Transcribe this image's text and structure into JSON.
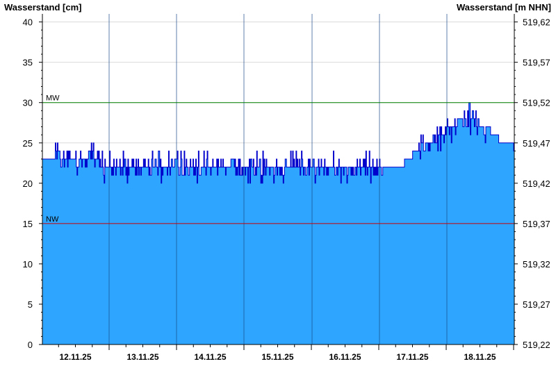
{
  "chart_data": {
    "type": "area",
    "left_axis_title": "Wasserstand [cm]",
    "right_axis_title": "Wasserstand [m NHN]",
    "ylim": [
      0,
      41
    ],
    "y_ticks": [
      0,
      5,
      10,
      15,
      20,
      25,
      30,
      35,
      40
    ],
    "y_tick_labels": [
      "0",
      "5",
      "10",
      "15",
      "20",
      "25",
      "30",
      "35",
      "40"
    ],
    "right_tick_labels": [
      "519,22",
      "519,27",
      "519,32",
      "519,37",
      "519,42",
      "519,47",
      "519,52",
      "519,57",
      "519,62"
    ],
    "x_range": [
      "2025-11-11T18:00",
      "2025-11-18T24:00"
    ],
    "day_boundaries": [
      "12.11.25 24:00",
      "13.11.25 24:00",
      "14.11.25 24:00",
      "15.11.25 24:00",
      "16.11.25 24:00",
      "17.11.25 24:00"
    ],
    "date_labels": [
      "12.11.25",
      "13.11.25",
      "14.11.25",
      "15.11.25",
      "16.11.25",
      "17.11.25",
      "18.11.25"
    ],
    "reference_lines": [
      {
        "label": "MW",
        "value": 30,
        "color": "#008000"
      },
      {
        "label": "NW",
        "value": 15,
        "color": "#cc0000"
      }
    ],
    "series": [
      {
        "x_hours_from_start": [
          0,
          6,
          12,
          18,
          24,
          30,
          36,
          42,
          48,
          54,
          60,
          66,
          72,
          78,
          84,
          90,
          96,
          102,
          108,
          114,
          120,
          126,
          132,
          138,
          144,
          150,
          156,
          162,
          168
        ],
        "values": [
          23,
          23,
          23,
          23,
          22,
          22,
          22,
          22,
          22,
          22,
          22,
          22,
          22,
          22,
          22,
          22,
          22,
          22,
          22,
          22,
          22,
          22,
          22,
          24,
          25,
          27,
          28,
          27,
          26,
          25
        ]
      }
    ],
    "fill_color": "#2ea6ff",
    "line_color": "#0000cc",
    "grid": true
  }
}
